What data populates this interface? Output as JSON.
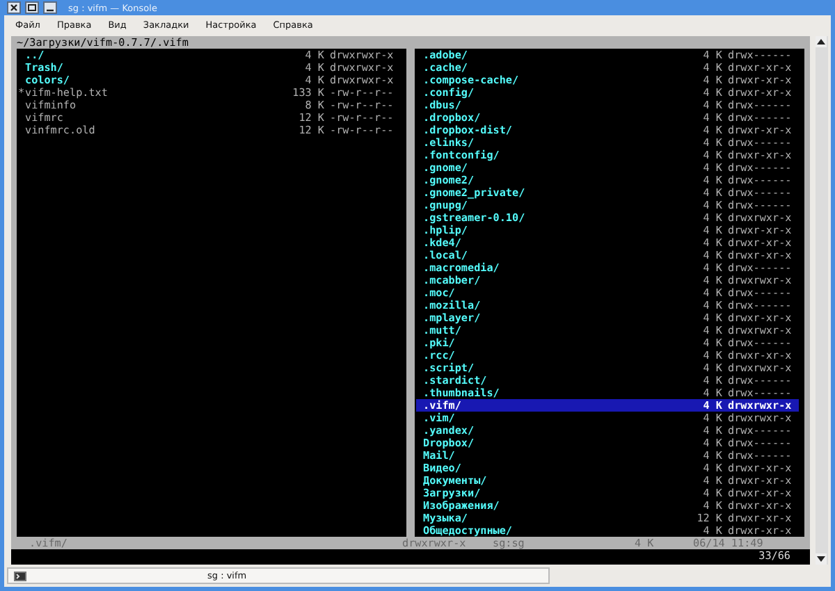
{
  "window": {
    "title": "sg : vifm — Konsole"
  },
  "menu": [
    "Файл",
    "Правка",
    "Вид",
    "Закладки",
    "Настройка",
    "Справка"
  ],
  "path": "~/Загрузки/vifm-0.7.7/.vifm",
  "left_pane": {
    "rows": [
      {
        "name": "../",
        "size": "4 K",
        "perms": "drwxrwxr-x",
        "kind": "dir",
        "selected": false
      },
      {
        "name": "Trash/",
        "size": "4 K",
        "perms": "drwxrwxr-x",
        "kind": "dir",
        "selected": false
      },
      {
        "name": "colors/",
        "size": "4 K",
        "perms": "drwxrwxr-x",
        "kind": "dir",
        "selected": false
      },
      {
        "mark": "*",
        "name": "vifm-help.txt",
        "size": "133 K",
        "perms": "-rw-r--r--",
        "kind": "file",
        "selected": false
      },
      {
        "name": "vifminfo",
        "size": "8 K",
        "perms": "-rw-r--r--",
        "kind": "file",
        "selected": false
      },
      {
        "name": "vifmrc",
        "size": "12 K",
        "perms": "-rw-r--r--",
        "kind": "file",
        "selected": false
      },
      {
        "name": "vinfmrc.old",
        "size": "12 K",
        "perms": "-rw-r--r--",
        "kind": "file",
        "selected": false
      }
    ]
  },
  "right_pane": {
    "rows": [
      {
        "name": ".adobe/",
        "size": "4 K",
        "perms": "drwx------",
        "kind": "dir",
        "selected": false
      },
      {
        "name": ".cache/",
        "size": "4 K",
        "perms": "drwxr-xr-x",
        "kind": "dir",
        "selected": false
      },
      {
        "name": ".compose-cache/",
        "size": "4 K",
        "perms": "drwxr-xr-x",
        "kind": "dir",
        "selected": false
      },
      {
        "name": ".config/",
        "size": "4 K",
        "perms": "drwxr-xr-x",
        "kind": "dir",
        "selected": false
      },
      {
        "name": ".dbus/",
        "size": "4 K",
        "perms": "drwx------",
        "kind": "dir",
        "selected": false
      },
      {
        "name": ".dropbox/",
        "size": "4 K",
        "perms": "drwx------",
        "kind": "dir",
        "selected": false
      },
      {
        "name": ".dropbox-dist/",
        "size": "4 K",
        "perms": "drwxr-xr-x",
        "kind": "dir",
        "selected": false
      },
      {
        "name": ".elinks/",
        "size": "4 K",
        "perms": "drwx------",
        "kind": "dir",
        "selected": false
      },
      {
        "name": ".fontconfig/",
        "size": "4 K",
        "perms": "drwxr-xr-x",
        "kind": "dir",
        "selected": false
      },
      {
        "name": ".gnome/",
        "size": "4 K",
        "perms": "drwx------",
        "kind": "dir",
        "selected": false
      },
      {
        "name": ".gnome2/",
        "size": "4 K",
        "perms": "drwx------",
        "kind": "dir",
        "selected": false
      },
      {
        "name": ".gnome2_private/",
        "size": "4 K",
        "perms": "drwx------",
        "kind": "dir",
        "selected": false
      },
      {
        "name": ".gnupg/",
        "size": "4 K",
        "perms": "drwx------",
        "kind": "dir",
        "selected": false
      },
      {
        "name": ".gstreamer-0.10/",
        "size": "4 K",
        "perms": "drwxrwxr-x",
        "kind": "dir",
        "selected": false
      },
      {
        "name": ".hplip/",
        "size": "4 K",
        "perms": "drwxr-xr-x",
        "kind": "dir",
        "selected": false
      },
      {
        "name": ".kde4/",
        "size": "4 K",
        "perms": "drwxr-xr-x",
        "kind": "dir",
        "selected": false
      },
      {
        "name": ".local/",
        "size": "4 K",
        "perms": "drwxr-xr-x",
        "kind": "dir",
        "selected": false
      },
      {
        "name": ".macromedia/",
        "size": "4 K",
        "perms": "drwx------",
        "kind": "dir",
        "selected": false
      },
      {
        "name": ".mcabber/",
        "size": "4 K",
        "perms": "drwxrwxr-x",
        "kind": "dir",
        "selected": false
      },
      {
        "name": ".moc/",
        "size": "4 K",
        "perms": "drwx------",
        "kind": "dir",
        "selected": false
      },
      {
        "name": ".mozilla/",
        "size": "4 K",
        "perms": "drwx------",
        "kind": "dir",
        "selected": false
      },
      {
        "name": ".mplayer/",
        "size": "4 K",
        "perms": "drwxr-xr-x",
        "kind": "dir",
        "selected": false
      },
      {
        "name": ".mutt/",
        "size": "4 K",
        "perms": "drwxrwxr-x",
        "kind": "dir",
        "selected": false
      },
      {
        "name": ".pki/",
        "size": "4 K",
        "perms": "drwx------",
        "kind": "dir",
        "selected": false
      },
      {
        "name": ".rcc/",
        "size": "4 K",
        "perms": "drwxr-xr-x",
        "kind": "dir",
        "selected": false
      },
      {
        "name": ".script/",
        "size": "4 K",
        "perms": "drwxrwxr-x",
        "kind": "dir",
        "selected": false
      },
      {
        "name": ".stardict/",
        "size": "4 K",
        "perms": "drwx------",
        "kind": "dir",
        "selected": false
      },
      {
        "name": ".thumbnails/",
        "size": "4 K",
        "perms": "drwx------",
        "kind": "dir",
        "selected": false
      },
      {
        "name": ".vifm/",
        "size": "4 K",
        "perms": "drwxrwxr-x",
        "kind": "dir",
        "selected": true
      },
      {
        "name": ".vim/",
        "size": "4 K",
        "perms": "drwxrwxr-x",
        "kind": "dir",
        "selected": false
      },
      {
        "name": ".yandex/",
        "size": "4 K",
        "perms": "drwx------",
        "kind": "dir",
        "selected": false
      },
      {
        "name": "Dropbox/",
        "size": "4 K",
        "perms": "drwx------",
        "kind": "dir",
        "selected": false
      },
      {
        "name": "Mail/",
        "size": "4 K",
        "perms": "drwx------",
        "kind": "dir",
        "selected": false
      },
      {
        "name": "Видео/",
        "size": "4 K",
        "perms": "drwxr-xr-x",
        "kind": "dir",
        "selected": false
      },
      {
        "name": "Документы/",
        "size": "4 K",
        "perms": "drwxr-xr-x",
        "kind": "dir",
        "selected": false
      },
      {
        "name": "Загрузки/",
        "size": "4 K",
        "perms": "drwxr-xr-x",
        "kind": "dir",
        "selected": false
      },
      {
        "name": "Изображения/",
        "size": "4 K",
        "perms": "drwxr-xr-x",
        "kind": "dir",
        "selected": false
      },
      {
        "name": "Музыка/",
        "size": "12 K",
        "perms": "drwxr-xr-x",
        "kind": "dir",
        "selected": false
      },
      {
        "name": "Общедоступные/",
        "size": "4 K",
        "perms": "drwxr-xr-x",
        "kind": "dir",
        "selected": false
      }
    ]
  },
  "status_line": {
    "name": ".vifm/",
    "perms": "drwxrwxr-x",
    "owner": "sg:sg",
    "size": "4 K",
    "date": "06/14 11:49"
  },
  "position": "33/66",
  "tab_bar": {
    "tab": "sg : vifm"
  }
}
